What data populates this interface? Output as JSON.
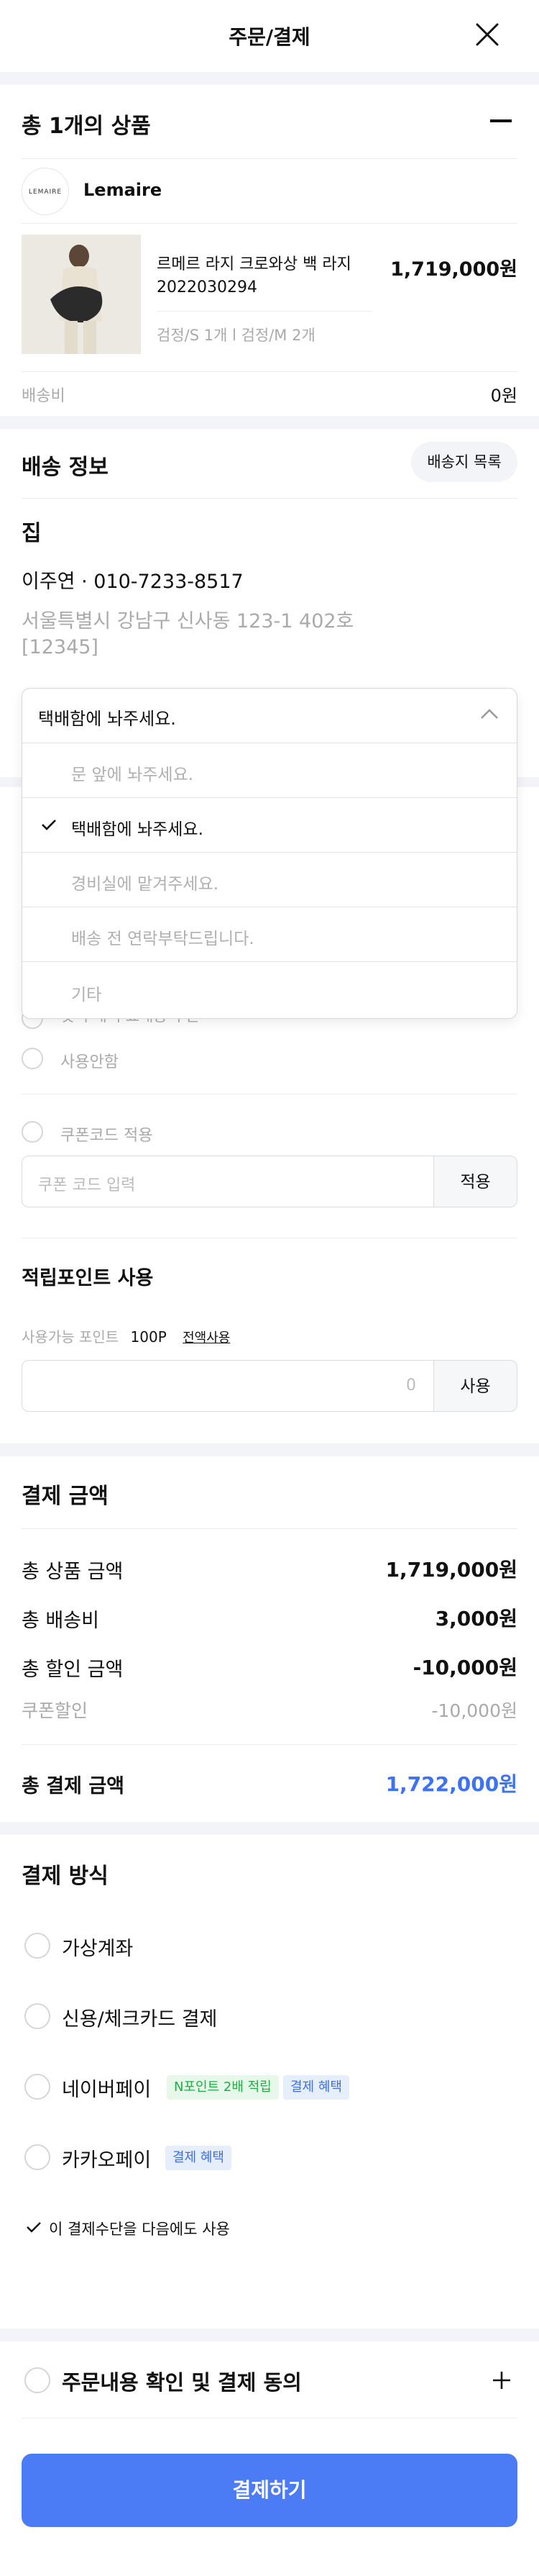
{
  "header": {
    "title": "주문/결제"
  },
  "products": {
    "title": "총 1개의 상품",
    "brand": {
      "logo_text": "LEMAIRE",
      "name": "Lemaire"
    },
    "item": {
      "name_line1": "르메르 라지 크로와상 백 라지",
      "name_line2": "2022030294",
      "price": "1,719,000원",
      "options": "검정/S 1개 l 검정/M 2개"
    },
    "shipping_label": "배송비",
    "shipping_value": "0원"
  },
  "delivery": {
    "title": "배송 정보",
    "list_button": "배송지 목록",
    "place": "집",
    "recipient": "이주연 · 010-7233-8517",
    "address": "서울특별시 강남구 신사동 123-1 402호",
    "zipcode": "[12345]",
    "request_selected": "택배함에 놔주세요.",
    "request_options": [
      "문 앞에 놔주세요.",
      "택배함에 놔주세요.",
      "경비실에 맡겨주세요.",
      "배송 전 연락부탁드립니다.",
      "기타"
    ]
  },
  "discount": {
    "partial_hidden_option": "첫 구매 무료배송 쿠폰",
    "no_use": "사용안함",
    "coupon_apply": "쿠폰코드 적용",
    "coupon_placeholder": "쿠폰 코드 입력",
    "coupon_button": "적용",
    "points_title": "적립포인트 사용",
    "points_available_label": "사용가능 포인트",
    "points_available_value": "100P",
    "points_use_all": "전액사용",
    "points_input_placeholder": "0",
    "points_button": "사용"
  },
  "payment_amount": {
    "title": "결제 금액",
    "rows": [
      {
        "label": "총 상품 금액",
        "value": "1,719,000원"
      },
      {
        "label": "총 배송비",
        "value": "3,000원"
      },
      {
        "label": "총 할인 금액",
        "value": "-10,000원"
      }
    ],
    "sub_label": "쿠폰할인",
    "sub_value": "-10,000원",
    "total_label": "총 결제 금액",
    "total_value": "1,722,000원"
  },
  "payment_method": {
    "title": "결제 방식",
    "options": [
      "가상계좌",
      "신용/체크카드 결제",
      "네이버페이",
      "카카오페이"
    ],
    "naver_badges": [
      "N포인트 2배 적립",
      "결제 혜택"
    ],
    "kakao_badge": "결제 혜택",
    "remember": "이 결제수단을 다음에도 사용"
  },
  "agreement": {
    "title": "주문내용 확인 및 결제 동의"
  },
  "cta": {
    "label": "결제하기"
  },
  "colors": {
    "accent": "#4b7cf6",
    "total_blue": "#3d72f0",
    "badge_green": "#1fae45"
  },
  "icons": [
    "close-icon",
    "minus-icon",
    "chevron-up-icon",
    "check-icon",
    "plus-icon"
  ]
}
